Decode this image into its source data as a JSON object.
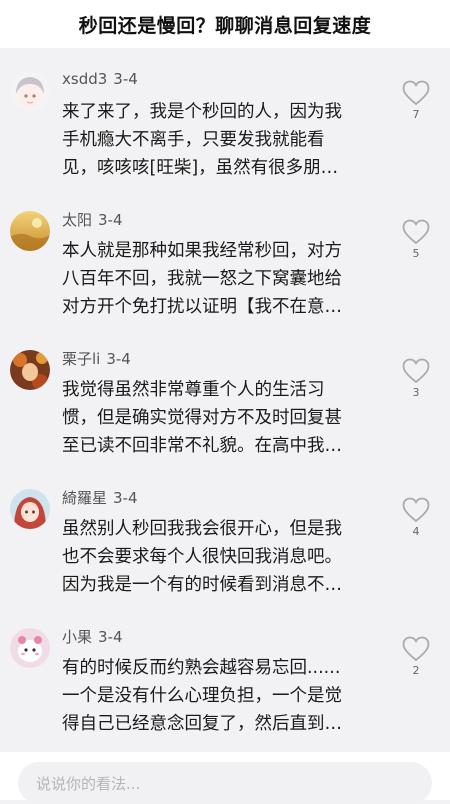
{
  "header": {
    "title": "秒回还是慢回？聊聊消息回复速度"
  },
  "comments": [
    {
      "author": "xsdd3",
      "date": "3-4",
      "likes": "7",
      "avatar_icon": "anime-boy-avatar-icon",
      "lines": [
        "来了来了，我是个秒回的人，因为我",
        "手机瘾大不离手，只要发我就能看",
        "见，咳咳咳[旺柴]，虽然有很多朋…"
      ]
    },
    {
      "author": "太阳",
      "date": "3-4",
      "likes": "5",
      "avatar_icon": "golden-landscape-avatar-icon",
      "lines": [
        "本人就是那种如果我经常秒回，对方",
        "八百年不回，我就一怒之下窝囊地给",
        "对方开个免打扰以证明【我不在意…"
      ]
    },
    {
      "author": "栗子li",
      "date": "3-4",
      "likes": "3",
      "avatar_icon": "autumn-character-avatar-icon",
      "lines": [
        "我觉得虽然非常尊重个人的生活习",
        "惯，但是确实觉得对方不及时回复甚",
        "至已读不回非常不礼貌。在高中我…"
      ]
    },
    {
      "author": "綺羅星",
      "date": "3-4",
      "likes": "4",
      "avatar_icon": "anime-girl-avatar-icon",
      "lines": [
        "虽然别人秒回我我会很开心，但是我",
        "也不会要求每个人很快回我消息吧。",
        "因为我是一个有的时候看到消息不…"
      ]
    },
    {
      "author": "小果",
      "date": "3-4",
      "likes": "2",
      "avatar_icon": "cute-character-avatar-icon",
      "lines": [
        "有的时候反而约熟会越容易忘回......",
        "一个是没有什么心理负担，一个是觉",
        "得自己已经意念回复了，然后直到…"
      ]
    }
  ],
  "footer": {
    "input_placeholder": "说说你的看法..."
  },
  "colors": {
    "background": "#f2f2f4",
    "text": "#1a1a1a",
    "meta": "#555555",
    "heart_outline": "#aaaaaa",
    "input_bg": "#f1f1f3"
  }
}
